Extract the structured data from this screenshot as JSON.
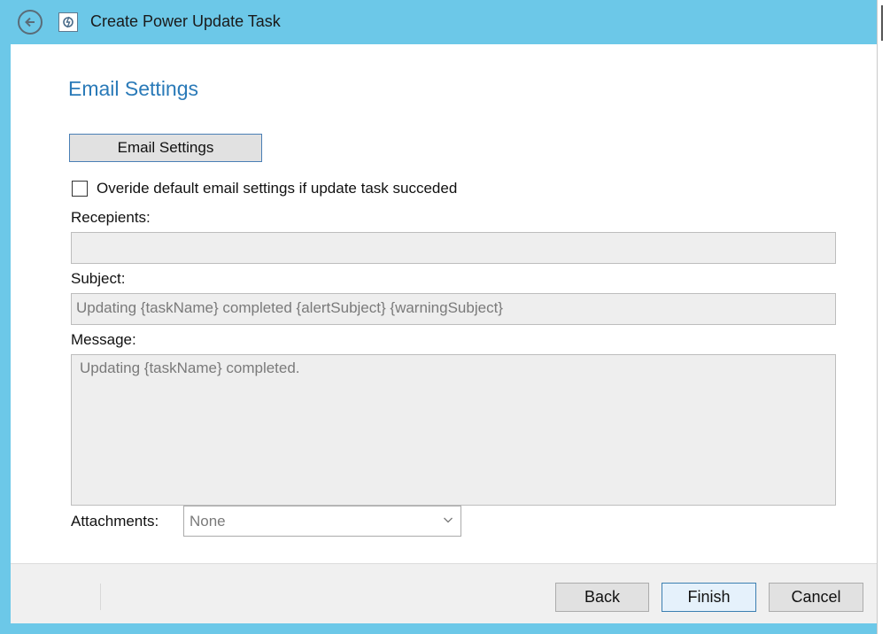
{
  "window": {
    "title": "Create Power Update Task"
  },
  "page": {
    "heading": "Email Settings"
  },
  "email_settings_button": "Email Settings",
  "override_checkbox": {
    "label": "Overide default email settings if update task succeded",
    "checked": false
  },
  "recipients": {
    "label": "Recepients:",
    "value": ""
  },
  "subject": {
    "label": "Subject:",
    "value": "Updating {taskName} completed {alertSubject} {warningSubject}"
  },
  "message": {
    "label": "Message:",
    "value": "Updating {taskName} completed."
  },
  "attachments": {
    "label": "Attachments:",
    "selected": "None"
  },
  "footer": {
    "back_label": "Back",
    "finish_label": "Finish",
    "cancel_label": "Cancel"
  },
  "colors": {
    "title_bar": "#6cc8e8",
    "heading": "#2a7ab8",
    "default_button_border": "#3c7fb1"
  },
  "icons": {
    "back": "back-arrow-circle-icon",
    "app": "power-update-icon",
    "dropdown": "chevron-down-icon"
  }
}
